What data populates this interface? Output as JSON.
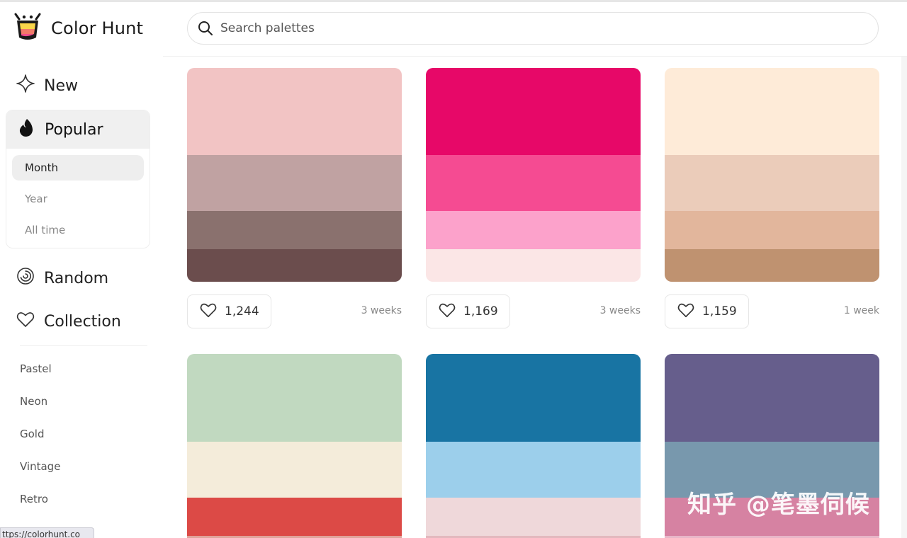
{
  "app": {
    "title": "Color Hunt"
  },
  "search": {
    "placeholder": "Search palettes"
  },
  "sidebar": {
    "new_label": "New",
    "popular_label": "Popular",
    "popular_sub": [
      "Month",
      "Year",
      "All time"
    ],
    "random_label": "Random",
    "collection_label": "Collection",
    "tags": [
      "Pastel",
      "Neon",
      "Gold",
      "Vintage",
      "Retro"
    ]
  },
  "palettes": [
    {
      "colors": [
        "#F2C4C4",
        "#C0A2A2",
        "#8A716E",
        "#6B4D4D"
      ],
      "likes": "1,244",
      "age": "3 weeks"
    },
    {
      "colors": [
        "#E70868",
        "#F54B92",
        "#FCA2CB",
        "#FBE6E6"
      ],
      "likes": "1,169",
      "age": "3 weeks"
    },
    {
      "colors": [
        "#FEEBD8",
        "#EBCCBA",
        "#E2B69C",
        "#BF9270"
      ],
      "likes": "1,159",
      "age": "1 week"
    },
    {
      "colors": [
        "#C1D9C0",
        "#F4ECDA",
        "#DC4A46",
        "#E0A39A"
      ]
    },
    {
      "colors": [
        "#1874A3",
        "#9CCFEB",
        "#EFD8DA",
        "#E3B8BE"
      ]
    },
    {
      "colors": [
        "#665E8C",
        "#7898AD",
        "#D682A2",
        "#E8B6C8"
      ]
    }
  ],
  "status_bar": {
    "url": "ttps://colorhunt.co"
  },
  "watermark": "知乎 @笔墨伺候",
  "colors": {
    "active_bg": "#EEEEEE",
    "border": "#E6E6E6",
    "muted_text": "#888888"
  }
}
